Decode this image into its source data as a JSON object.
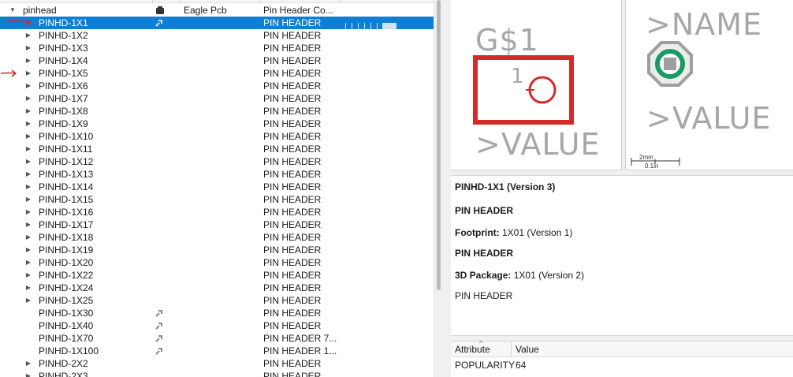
{
  "tree": {
    "columns": [
      "",
      "",
      "Eagle Pcb",
      "Pin Header Co..."
    ],
    "root": {
      "label": "pinhead",
      "expanded": true
    },
    "rows": [
      {
        "name": "PINHD-1X1",
        "desc": "PIN HEADER",
        "selected": true,
        "arrow": true,
        "expander": false,
        "icon": "model-icon",
        "ticks": true
      },
      {
        "name": "PINHD-1X2",
        "desc": "PIN HEADER",
        "expander": true
      },
      {
        "name": "PINHD-1X3",
        "desc": "PIN HEADER",
        "expander": true
      },
      {
        "name": "PINHD-1X4",
        "desc": "PIN HEADER",
        "expander": true
      },
      {
        "name": "PINHD-1X5",
        "desc": "PIN HEADER",
        "expander": true,
        "arrow": true
      },
      {
        "name": "PINHD-1X6",
        "desc": "PIN HEADER",
        "expander": true
      },
      {
        "name": "PINHD-1X7",
        "desc": "PIN HEADER",
        "expander": true
      },
      {
        "name": "PINHD-1X8",
        "desc": "PIN HEADER",
        "expander": true
      },
      {
        "name": "PINHD-1X9",
        "desc": "PIN HEADER",
        "expander": true
      },
      {
        "name": "PINHD-1X10",
        "desc": "PIN HEADER",
        "expander": true
      },
      {
        "name": "PINHD-1X11",
        "desc": "PIN HEADER",
        "expander": true
      },
      {
        "name": "PINHD-1X12",
        "desc": "PIN HEADER",
        "expander": true
      },
      {
        "name": "PINHD-1X13",
        "desc": "PIN HEADER",
        "expander": true
      },
      {
        "name": "PINHD-1X14",
        "desc": "PIN HEADER",
        "expander": true
      },
      {
        "name": "PINHD-1X15",
        "desc": "PIN HEADER",
        "expander": true
      },
      {
        "name": "PINHD-1X16",
        "desc": "PIN HEADER",
        "expander": true
      },
      {
        "name": "PINHD-1X17",
        "desc": "PIN HEADER",
        "expander": true
      },
      {
        "name": "PINHD-1X18",
        "desc": "PIN HEADER",
        "expander": true
      },
      {
        "name": "PINHD-1X19",
        "desc": "PIN HEADER",
        "expander": true
      },
      {
        "name": "PINHD-1X20",
        "desc": "PIN HEADER",
        "expander": true
      },
      {
        "name": "PINHD-1X22",
        "desc": "PIN HEADER",
        "expander": true
      },
      {
        "name": "PINHD-1X24",
        "desc": "PIN HEADER",
        "expander": true
      },
      {
        "name": "PINHD-1X25",
        "desc": "PIN HEADER",
        "expander": true
      },
      {
        "name": "PINHD-1X30",
        "desc": "PIN HEADER",
        "expander": false,
        "icon": "wrench-icon"
      },
      {
        "name": "PINHD-1X40",
        "desc": "PIN HEADER",
        "expander": false,
        "icon": "wrench-icon"
      },
      {
        "name": "PINHD-1X70",
        "desc": "PIN HEADER 7...",
        "expander": false,
        "icon": "wrench-icon"
      },
      {
        "name": "PINHD-1X100",
        "desc": "PIN HEADER 1...",
        "expander": false,
        "icon": "wrench-icon"
      },
      {
        "name": "PINHD-2X2",
        "desc": "PIN HEADER",
        "expander": true
      },
      {
        "name": "PINHD-2X3",
        "desc": "PIN HEADER",
        "expander": true
      }
    ]
  },
  "symbol_preview": {
    "name": "G$1",
    "pin_number": "1",
    "value": ">VALUE",
    "colors": {
      "body": "#d42a2a",
      "text": "#a7a7a7"
    }
  },
  "package_preview": {
    "name": ">NAME",
    "value": ">VALUE",
    "scale_top": "2mm",
    "scale_bottom": "0.1in",
    "colors": {
      "pad_outer": "#9e9e9e",
      "pad_ring": "#1b9a63",
      "pad_inner": "#bdbdbd"
    }
  },
  "description": {
    "title": "PINHD-1X1 (Version 3)",
    "subtitle": "PIN HEADER",
    "footprint_label": "Footprint:",
    "footprint_value": "1X01 (Version 1)",
    "footprint_desc": "PIN HEADER",
    "package_label": "3D Package:",
    "package_value": "1X01 (Version 2)",
    "package_desc": "PIN HEADER"
  },
  "attributes": {
    "headers": [
      "Attribute",
      "Value"
    ],
    "rows": [
      {
        "attribute": "POPULARITY",
        "value": "64"
      }
    ]
  },
  "colors": {
    "selection": "#0f7fd6",
    "annotation_arrow": "#d42a2a"
  }
}
